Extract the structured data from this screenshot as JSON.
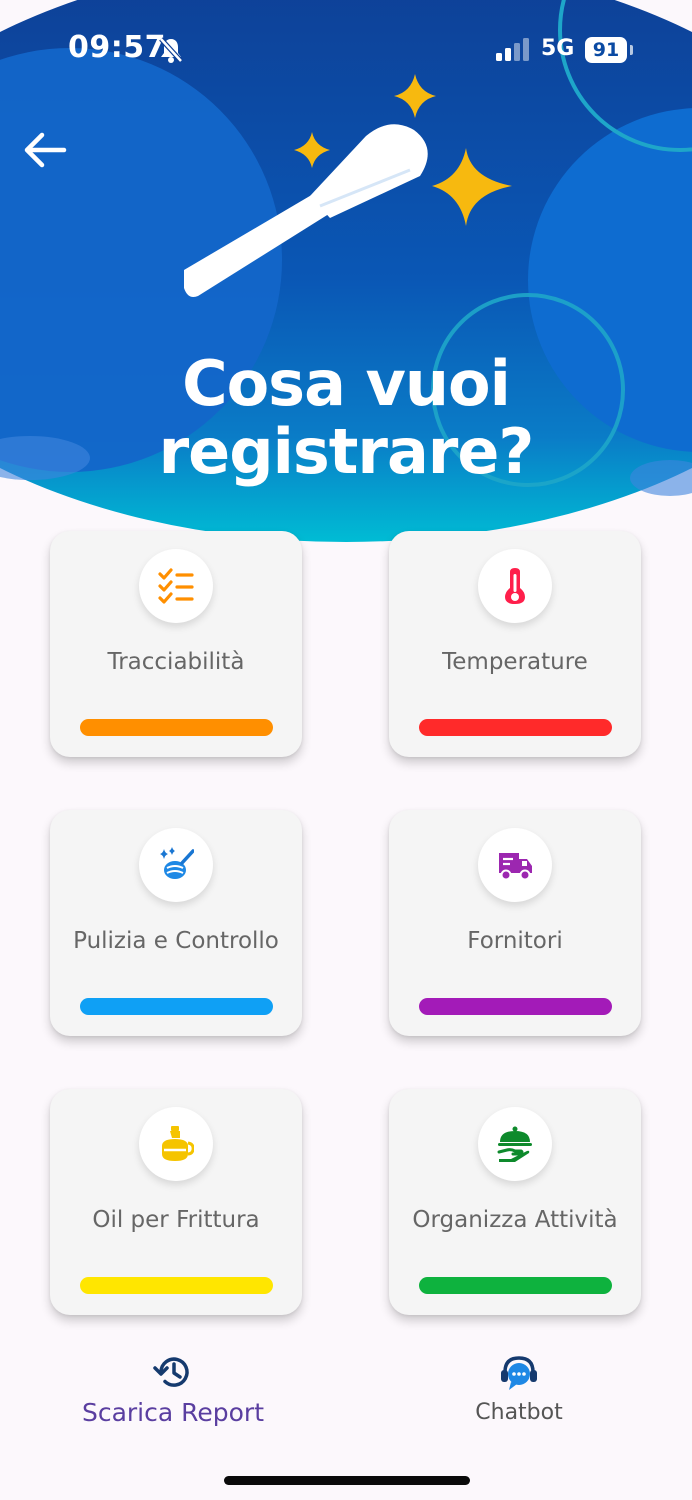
{
  "status_bar": {
    "time": "09:57",
    "network": "5G",
    "battery": "91"
  },
  "header": {
    "back_icon": "arrow-left-icon",
    "illustration": "magic-wand-icon",
    "title_line1": "Cosa vuoi",
    "title_line2": "registrare?"
  },
  "cards": [
    {
      "label": "Tracciabilità",
      "icon": "checklist-icon",
      "color": "#ff8f00"
    },
    {
      "label": "Temperature",
      "icon": "thermometer-icon",
      "color": "#ff2a2a"
    },
    {
      "label": "Pulizia e Controllo",
      "icon": "cleaning-icon",
      "color": "#0fa0f5"
    },
    {
      "label": "Fornitori",
      "icon": "truck-icon",
      "color": "#a31bb8"
    },
    {
      "label": "Oil per Frittura",
      "icon": "oil-jug-icon",
      "color": "#ffe600"
    },
    {
      "label": "Organizza Attività",
      "icon": "serving-cloche-icon",
      "color": "#0eb23e"
    }
  ],
  "bottom_nav": {
    "report_label": "Scarica Report",
    "report_icon": "history-icon",
    "report_color": "#5a3ea0",
    "chatbot_label": "Chatbot",
    "chatbot_icon": "support-agent-icon",
    "chatbot_color": "#555555"
  },
  "colors": {
    "hero_blue": "#0b4aa2",
    "hero_cyan": "#00b8d4",
    "star_yellow": "#f7b90f"
  }
}
